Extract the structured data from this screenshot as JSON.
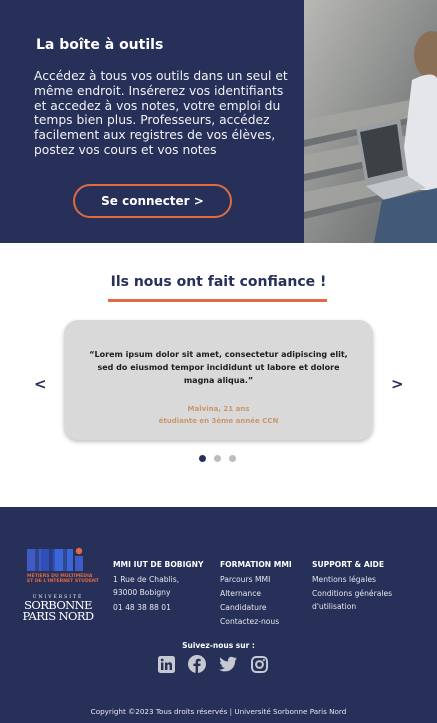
{
  "hero": {
    "title": "La boîte à outils",
    "text": "Accédez à tous vos outils dans un seul et même endroit. Insérerez vos identifiants et accedez à vos notes, votre emploi du temps bien plus. Professeurs, accédez facilement aux registres de vos élèves, postez vos cours et vos notes",
    "connect_label": "Se connecter >",
    "accent": "#e06a42",
    "background": "#273059"
  },
  "testimonials": {
    "title": "Ils nous ont fait confiance !",
    "quote": "“Lorem ipsum dolor sit amet, consectetur adipiscing elit, sed do eiusmod tempor incididunt ut labore et dolore magna aliqua.”",
    "author_name": "Malvina, 21 ans",
    "author_role": "étudiante en 3ème année CCN",
    "prev_label": "<",
    "next_label": ">",
    "slides_count": 3,
    "active_slide": 1
  },
  "footer": {
    "logo": {
      "mmi": "MMI",
      "mmi_sub_1": "MÉTIERS DU MULTIMÉDIA",
      "mmi_sub_2": "ET DE L'INTERNET STUDENT",
      "univ": "UNIVERSITÉ",
      "sorbonne_1": "SORBONNE",
      "sorbonne_2": "PARIS NORD"
    },
    "col1": {
      "title": "MMI IUT DE BOBIGNY",
      "address_1": "1 Rue de Chablis,",
      "address_2": "93000 Bobigny",
      "phone": "01 48 38 88 01"
    },
    "col2": {
      "title": "FORMATION MMI",
      "links": [
        "Parcours MMI",
        "Alternance",
        "Candidature",
        "Contactez-nous"
      ]
    },
    "col3": {
      "title": "SUPPORT & AIDE",
      "links": [
        "Mentions légales",
        "Conditions générales d'utilisation"
      ]
    },
    "follow": "Suivez-nous sur :",
    "socials": [
      "linkedin-icon",
      "facebook-icon",
      "twitter-icon",
      "instagram-icon"
    ],
    "copyright": "Copyright ©2023 Tous droits réservés | Université Sorbonne Paris Nord"
  }
}
